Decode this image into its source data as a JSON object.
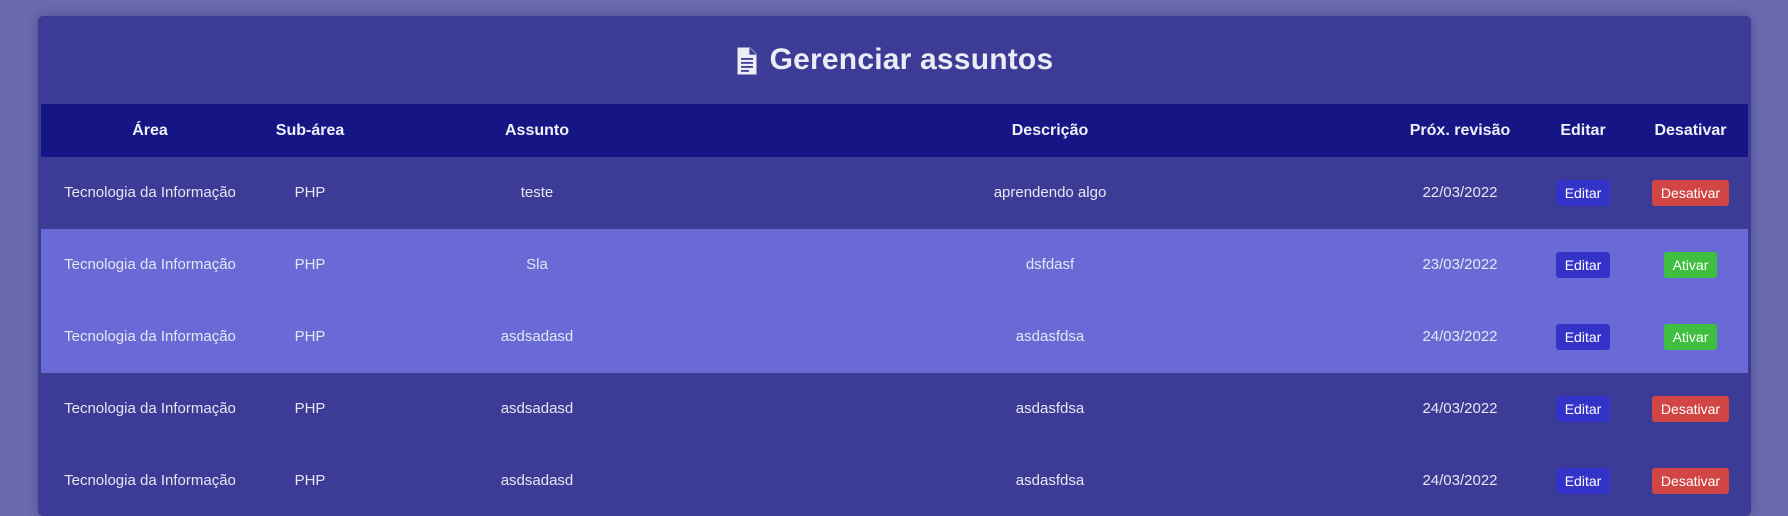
{
  "page": {
    "title": "Gerenciar assuntos",
    "title_icon": "document-icon"
  },
  "table": {
    "headers": [
      "Área",
      "Sub-área",
      "Assunto",
      "Descrição",
      "Próx. revisão",
      "Editar",
      "Desativar"
    ],
    "rows": [
      {
        "area": "Tecnologia da Informação",
        "subarea": "PHP",
        "assunto": "teste",
        "descricao": "aprendendo algo",
        "revisao": "22/03/2022",
        "edit_label": "Editar",
        "toggle_label": "Desativar",
        "toggle_state": "active",
        "highlighted": false
      },
      {
        "area": "Tecnologia da Informação",
        "subarea": "PHP",
        "assunto": "Sla",
        "descricao": "dsfdasf",
        "revisao": "23/03/2022",
        "edit_label": "Editar",
        "toggle_label": "Ativar",
        "toggle_state": "inactive",
        "highlighted": true
      },
      {
        "area": "Tecnologia da Informação",
        "subarea": "PHP",
        "assunto": "asdsadasd",
        "descricao": "asdasfdsa",
        "revisao": "24/03/2022",
        "edit_label": "Editar",
        "toggle_label": "Ativar",
        "toggle_state": "inactive",
        "highlighted": true
      },
      {
        "area": "Tecnologia da Informação",
        "subarea": "PHP",
        "assunto": "asdsadasd",
        "descricao": "asdasfdsa",
        "revisao": "24/03/2022",
        "edit_label": "Editar",
        "toggle_label": "Desativar",
        "toggle_state": "active",
        "highlighted": false
      },
      {
        "area": "Tecnologia da Informação",
        "subarea": "PHP",
        "assunto": "asdsadasd",
        "descricao": "asdasfdsa",
        "revisao": "24/03/2022",
        "edit_label": "Editar",
        "toggle_label": "Desativar",
        "toggle_state": "active",
        "highlighted": false
      }
    ]
  },
  "colors": {
    "background": "#6b6ab0",
    "card": "#3c3c96",
    "header_row": "#151585",
    "highlight_row": "#6a6ad6",
    "edit_button": "#3333c9",
    "deactivate_button": "#d24545",
    "activate_button": "#3fbe3f"
  }
}
